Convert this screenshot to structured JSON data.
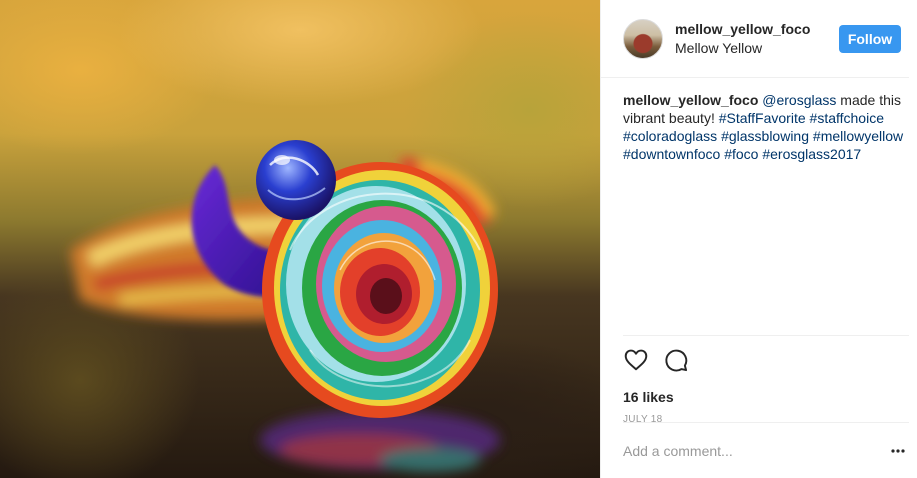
{
  "post": {
    "header": {
      "username": "mellow_yellow_foco",
      "location": "Mellow Yellow",
      "follow_label": "Follow"
    },
    "caption": {
      "username": "mellow_yellow_foco",
      "mention": "@erosglass",
      "text": " made this vibrant beauty! ",
      "hashtags": [
        "#StaffFavorite",
        "#staffchoice",
        "#coloradoglass",
        "#glassblowing",
        "#mellowyellow",
        "#downtownfoco",
        "#foco",
        "#erosglass2017"
      ]
    },
    "likes": "16 likes",
    "date": "JULY 18",
    "comment": {
      "placeholder": "Add a comment..."
    },
    "icons": {
      "like": "heart-icon",
      "comment": "comment-icon",
      "more": "more-options-icon"
    },
    "colors": {
      "follow_button": "#3897f0",
      "link": "#003569",
      "muted": "#999999"
    }
  }
}
